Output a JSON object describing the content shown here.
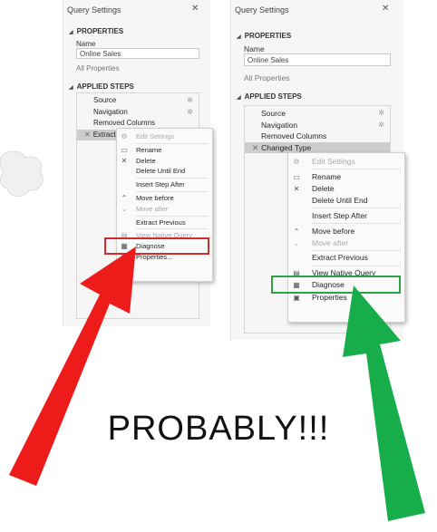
{
  "left_panel": {
    "title": "Query Settings",
    "close_glyph": "✕",
    "properties_header": "PROPERTIES",
    "name_label": "Name",
    "name_value": "Online Sales",
    "all_properties_link": "All Properties",
    "applied_steps_header": "APPLIED STEPS",
    "steps": [
      {
        "label": "Source",
        "gear": true
      },
      {
        "label": "Navigation",
        "gear": true
      },
      {
        "label": "Removed Columns",
        "gear": false
      },
      {
        "label": "Extracted",
        "gear": false,
        "selected": true
      }
    ],
    "menu": [
      {
        "label": "Edit Settings",
        "disabled": true,
        "icon": "gear-icon",
        "glyph": "⚙"
      },
      {
        "sep": true
      },
      {
        "label": "Rename",
        "disabled": false,
        "icon": "rename-icon",
        "glyph": "▭"
      },
      {
        "label": "Delete",
        "disabled": false,
        "icon": "delete-icon",
        "glyph": "✕"
      },
      {
        "label": "Delete Until End",
        "disabled": false,
        "icon": "",
        "glyph": ""
      },
      {
        "sep": true
      },
      {
        "label": "Insert Step After",
        "disabled": false,
        "icon": "",
        "glyph": ""
      },
      {
        "sep": true
      },
      {
        "label": "Move before",
        "disabled": false,
        "icon": "chevron-up-icon",
        "glyph": "⌃"
      },
      {
        "label": "Move after",
        "disabled": true,
        "icon": "chevron-down-icon",
        "glyph": "⌄"
      },
      {
        "sep": true
      },
      {
        "label": "Extract Previous",
        "disabled": false,
        "icon": "",
        "glyph": ""
      },
      {
        "sep": true
      },
      {
        "label": "View Native Query",
        "disabled": true,
        "icon": "native-query-icon",
        "glyph": "▤",
        "highlight": "red"
      },
      {
        "label": "Diagnose",
        "disabled": false,
        "icon": "diagnose-icon",
        "glyph": "▦"
      },
      {
        "label": "Properties...",
        "disabled": false,
        "icon": "properties-icon",
        "glyph": "▣"
      }
    ]
  },
  "right_panel": {
    "title": "Query Settings",
    "close_glyph": "✕",
    "properties_header": "PROPERTIES",
    "name_label": "Name",
    "name_value": "Online Sales",
    "all_properties_link": "All Properties",
    "applied_steps_header": "APPLIED STEPS",
    "steps": [
      {
        "label": "Source",
        "gear": true
      },
      {
        "label": "Navigation",
        "gear": true
      },
      {
        "label": "Removed Columns",
        "gear": false
      },
      {
        "label": "Changed Type",
        "gear": false,
        "selected": true
      }
    ],
    "menu": [
      {
        "label": "Edit Settings",
        "disabled": true,
        "icon": "gear-icon",
        "glyph": "⚙"
      },
      {
        "sep": true
      },
      {
        "label": "Rename",
        "disabled": false,
        "icon": "rename-icon",
        "glyph": "▭"
      },
      {
        "label": "Delete",
        "disabled": false,
        "icon": "delete-icon",
        "glyph": "✕"
      },
      {
        "label": "Delete Until End",
        "disabled": false,
        "icon": "",
        "glyph": ""
      },
      {
        "sep": true
      },
      {
        "label": "Insert Step After",
        "disabled": false,
        "icon": "",
        "glyph": ""
      },
      {
        "sep": true
      },
      {
        "label": "Move before",
        "disabled": false,
        "icon": "chevron-up-icon",
        "glyph": "⌃"
      },
      {
        "label": "Move after",
        "disabled": true,
        "icon": "chevron-down-icon",
        "glyph": "⌄"
      },
      {
        "sep": true
      },
      {
        "label": "Extract Previous",
        "disabled": false,
        "icon": "",
        "glyph": ""
      },
      {
        "sep": true
      },
      {
        "label": "View Native Query",
        "disabled": false,
        "icon": "native-query-icon",
        "glyph": "▤",
        "highlight": "green"
      },
      {
        "label": "Diagnose",
        "disabled": false,
        "icon": "diagnose-icon",
        "glyph": "▦"
      },
      {
        "label": "Properties",
        "disabled": false,
        "icon": "properties-icon",
        "glyph": "▣"
      }
    ]
  },
  "caption": "PROBABLY!!!",
  "colors": {
    "red_arrow": "#ee1b1b",
    "green_arrow": "#17ad4a",
    "red_box": "#d12c2c",
    "green_box": "#2aa344"
  }
}
